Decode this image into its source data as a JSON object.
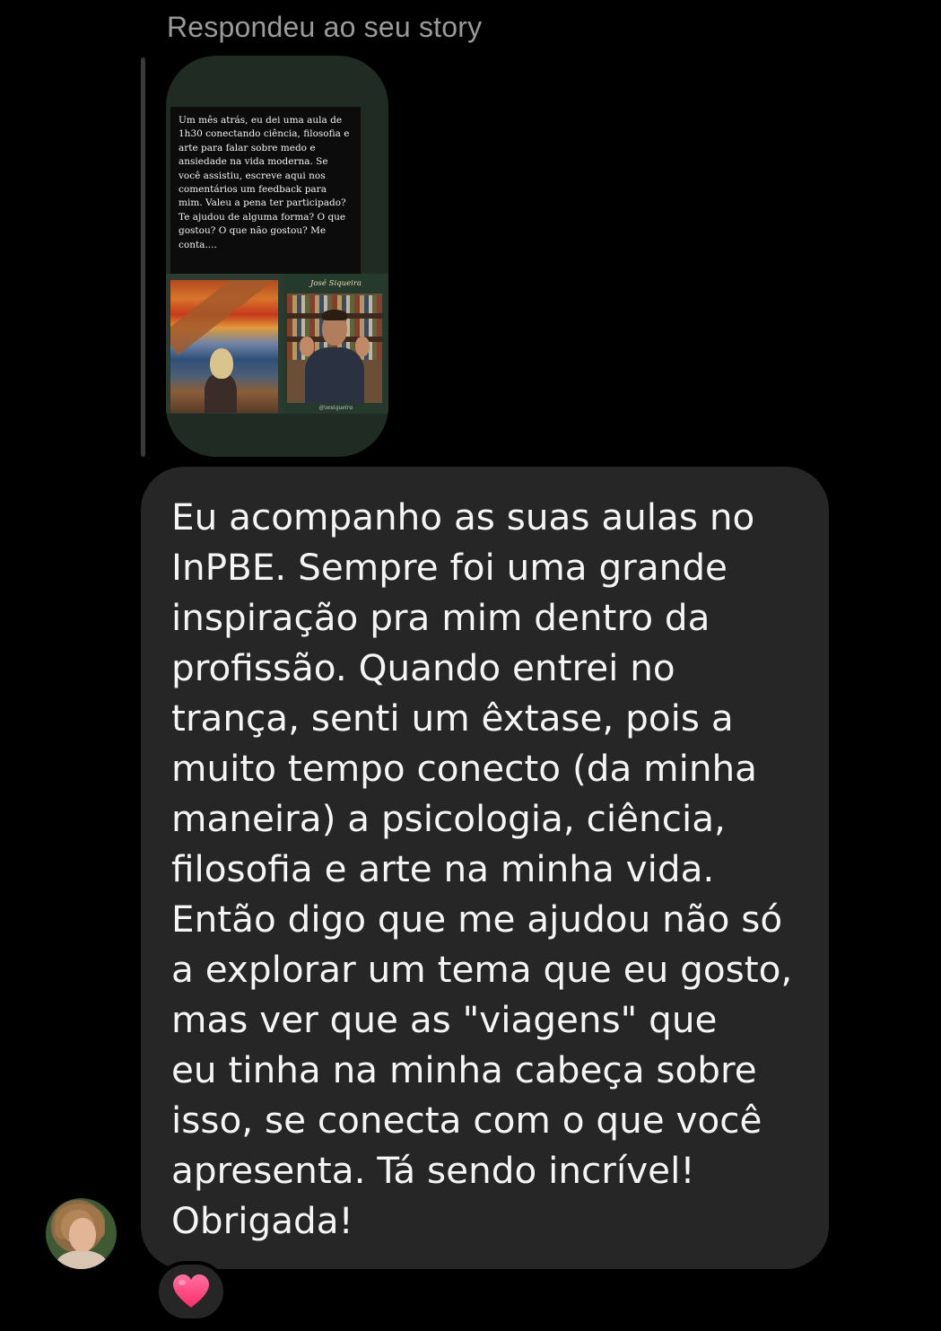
{
  "reply_header": "Respondeu ao seu story",
  "story": {
    "caption": "Um mês atrás, eu dei uma aula de 1h30 conectando ciência, filosofia e arte para falar sobre medo e ansiedade na vida moderna. Se você assistiu, escreve aqui nos comentários um feedback para mim. Valeu a pena ter participado? Te ajudou de alguma forma? O que gostou? O que não gostou?  Me conta....",
    "video_name": "José Siqueira",
    "video_handle": "@zesiqueira"
  },
  "message": {
    "text": "Eu acompanho as suas aulas no\nInPBE. Sempre foi uma grande\ninspiração pra mim dentro da\nprofissão. Quando entrei no\ntrança, senti um êxtase, pois a\nmuito tempo conecto (da minha\nmaneira) a psicologia, ciência,\nfilosofia e arte na minha vida.\nEntão digo que me ajudou não só\na explorar um tema que eu gosto,\nmas ver que as \"viagens\" que\neu tinha na minha cabeça sobre\nisso, se conecta com o que você\napresenta. Tá sendo incrível!\nObrigada!"
  },
  "reaction": {
    "icon": "heart-icon",
    "color": "#ff3f7f"
  },
  "colors": {
    "background": "#000000",
    "bubble": "#262626",
    "header_text": "#9a9a9a"
  }
}
